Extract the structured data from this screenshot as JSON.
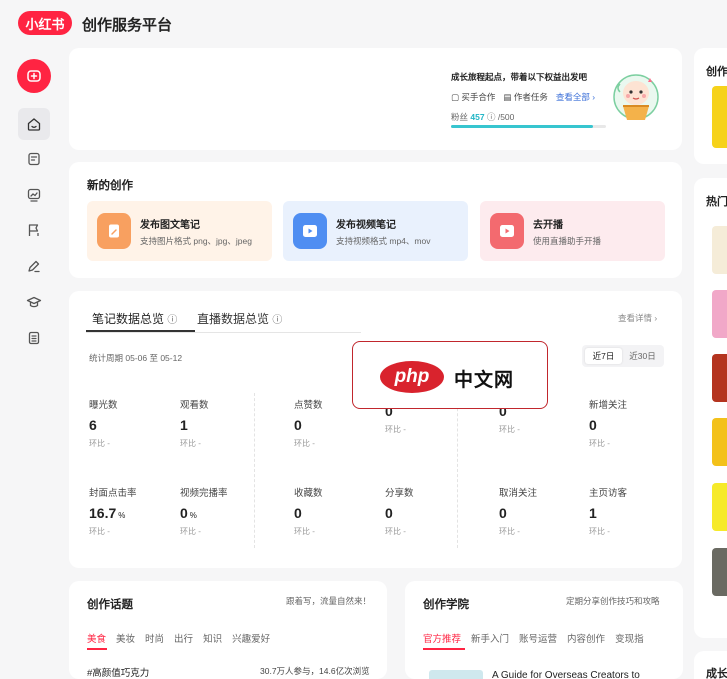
{
  "header": {
    "logo_text": "小红书",
    "platform_title": "创作服务平台"
  },
  "sidebar": {
    "items": [
      {
        "name": "home",
        "icon": "home-icon",
        "active": true
      },
      {
        "name": "notes",
        "icon": "note-icon"
      },
      {
        "name": "data",
        "icon": "chart-icon"
      },
      {
        "name": "fans",
        "icon": "flag-icon"
      },
      {
        "name": "inspiration",
        "icon": "pencil-icon"
      },
      {
        "name": "academy",
        "icon": "graduation-icon"
      },
      {
        "name": "docs",
        "icon": "document-icon"
      }
    ]
  },
  "banner": {
    "tip": "成长旅程起点，带着以下权益出发吧",
    "benefit_1": "买手合作",
    "benefit_2": "作者任务",
    "view_all": "查看全部",
    "fans_label": "粉丝",
    "fans_count": "457",
    "fans_target": "/500",
    "fans_progress": 0.914
  },
  "creation": {
    "title": "新的创作",
    "tiles": [
      {
        "name": "发布图文笔记",
        "desc": "支持图片格式 png、jpg、jpeg"
      },
      {
        "name": "发布视频笔记",
        "desc": "支持视频格式 mp4、mov"
      },
      {
        "name": "去开播",
        "desc": "使用直播助手开播"
      }
    ]
  },
  "overview": {
    "tab_notes": "笔记数据总览",
    "tab_live": "直播数据总览",
    "view_detail": "查看详情",
    "period": "统计周期 05-06 至 05-12",
    "range_7": "近7日",
    "range_30": "近30日",
    "compare_label": "环比",
    "compare_value": "-",
    "metrics": [
      {
        "label": "曝光数",
        "value": "6",
        "unit": ""
      },
      {
        "label": "观看数",
        "value": "1",
        "unit": ""
      },
      {
        "label": "点赞数",
        "value": "0",
        "unit": ""
      },
      {
        "label": "",
        "value": "0",
        "unit": ""
      },
      {
        "label": "",
        "value": "0",
        "unit": ""
      },
      {
        "label": "新增关注",
        "value": "0",
        "unit": ""
      },
      {
        "label": "封面点击率",
        "value": "16.7",
        "unit": "%"
      },
      {
        "label": "视频完播率",
        "value": "0",
        "unit": "%"
      },
      {
        "label": "收藏数",
        "value": "0",
        "unit": ""
      },
      {
        "label": "分享数",
        "value": "0",
        "unit": ""
      },
      {
        "label": "取消关注",
        "value": "0",
        "unit": ""
      },
      {
        "label": "主页访客",
        "value": "1",
        "unit": ""
      }
    ]
  },
  "watermark": {
    "php": "php",
    "cn": "中文网"
  },
  "topics": {
    "title": "创作话题",
    "subtitle": "跟着写，流量自然来！",
    "tabs": [
      "美食",
      "美妆",
      "时尚",
      "出行",
      "知识",
      "兴趣爱好"
    ],
    "row_title": "#高颜值巧克力",
    "row_stat": "30.7万人参与，14.6亿次浏览"
  },
  "academy": {
    "title": "创作学院",
    "subtitle": "定期分享创作技巧和攻略",
    "tabs": [
      "官方推荐",
      "新手入门",
      "账号运营",
      "内容创作",
      "变现指"
    ],
    "item_title": "A Guide for Overseas Creators to"
  },
  "right": {
    "card1_title": "创作",
    "card2_title": "热门",
    "card3_title": "成长"
  },
  "colors": {
    "brand": "#ff2442",
    "progress": "#37c5cf",
    "link": "#3b6fd8"
  }
}
